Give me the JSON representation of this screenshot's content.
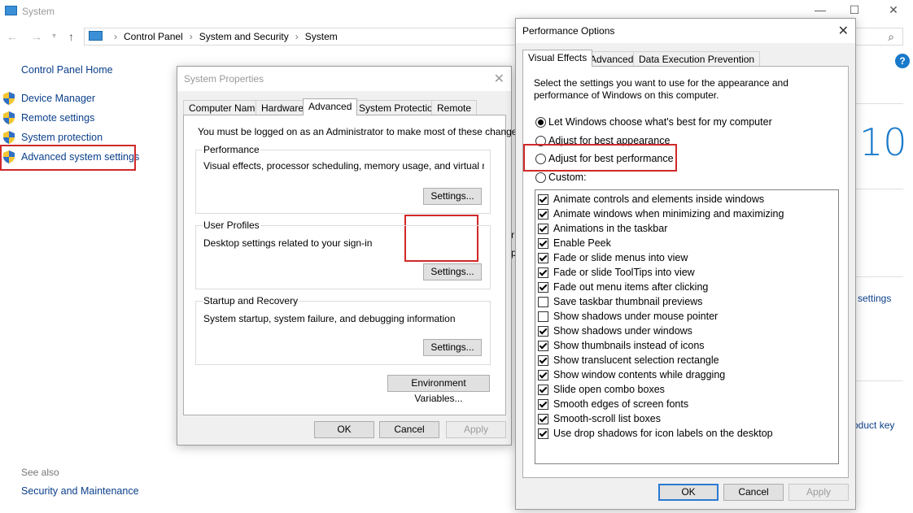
{
  "window": {
    "title": "System",
    "breadcrumbs": [
      "Control Panel",
      "System and Security",
      "System"
    ],
    "help_label": "?"
  },
  "left_pane": {
    "home": "Control Panel Home",
    "items": [
      {
        "label": "Device Manager"
      },
      {
        "label": "Remote settings"
      },
      {
        "label": "System protection"
      },
      {
        "label": "Advanced system settings"
      }
    ],
    "see_also": "See also",
    "security_maintenance": "Security and Maintenance"
  },
  "background": {
    "win_version": "10",
    "settings_frag": "settings",
    "product_key_frag": "oduct key",
    "frag_r": "r",
    "frag_p": "p"
  },
  "sysprops": {
    "title": "System Properties",
    "tabs": [
      "Computer Name",
      "Hardware",
      "Advanced",
      "System Protection",
      "Remote"
    ],
    "selected_tab": "Advanced",
    "admin_note": "You must be logged on as an Administrator to make most of these changes.",
    "performance": {
      "label": "Performance",
      "desc": "Visual effects, processor scheduling, memory usage, and virtual memory",
      "button": "Settings..."
    },
    "user_profiles": {
      "label": "User Profiles",
      "desc": "Desktop settings related to your sign-in",
      "button": "Settings..."
    },
    "startup": {
      "label": "Startup and Recovery",
      "desc": "System startup, system failure, and debugging information",
      "button": "Settings..."
    },
    "env_button": "Environment Variables...",
    "ok": "OK",
    "cancel": "Cancel",
    "apply": "Apply"
  },
  "perf": {
    "title": "Performance Options",
    "tabs": [
      "Visual Effects",
      "Advanced",
      "Data Execution Prevention"
    ],
    "selected_tab": "Visual Effects",
    "intro": [
      "Select the settings you want to use for the appearance and",
      "performance of Windows on this computer."
    ],
    "options": [
      {
        "label": "Let Windows choose what's best for my computer",
        "selected": true
      },
      {
        "label": "Adjust for best appearance",
        "selected": false
      },
      {
        "label": "Adjust for best performance",
        "selected": false
      },
      {
        "label": "Custom:",
        "selected": false
      }
    ],
    "effects": [
      {
        "label": "Animate controls and elements inside windows",
        "checked": true
      },
      {
        "label": "Animate windows when minimizing and maximizing",
        "checked": true
      },
      {
        "label": "Animations in the taskbar",
        "checked": true
      },
      {
        "label": "Enable Peek",
        "checked": true
      },
      {
        "label": "Fade or slide menus into view",
        "checked": true
      },
      {
        "label": "Fade or slide ToolTips into view",
        "checked": true
      },
      {
        "label": "Fade out menu items after clicking",
        "checked": true
      },
      {
        "label": "Save taskbar thumbnail previews",
        "checked": false
      },
      {
        "label": "Show shadows under mouse pointer",
        "checked": false
      },
      {
        "label": "Show shadows under windows",
        "checked": true
      },
      {
        "label": "Show thumbnails instead of icons",
        "checked": true
      },
      {
        "label": "Show translucent selection rectangle",
        "checked": true
      },
      {
        "label": "Show window contents while dragging",
        "checked": true
      },
      {
        "label": "Slide open combo boxes",
        "checked": true
      },
      {
        "label": "Smooth edges of screen fonts",
        "checked": true
      },
      {
        "label": "Smooth-scroll list boxes",
        "checked": true
      },
      {
        "label": "Use drop shadows for icon labels on the desktop",
        "checked": true
      }
    ],
    "ok": "OK",
    "cancel": "Cancel",
    "apply": "Apply"
  },
  "colors": {
    "highlight_red": "#d02929",
    "link_blue": "#0b3f8a",
    "accent": "#1979ca"
  }
}
